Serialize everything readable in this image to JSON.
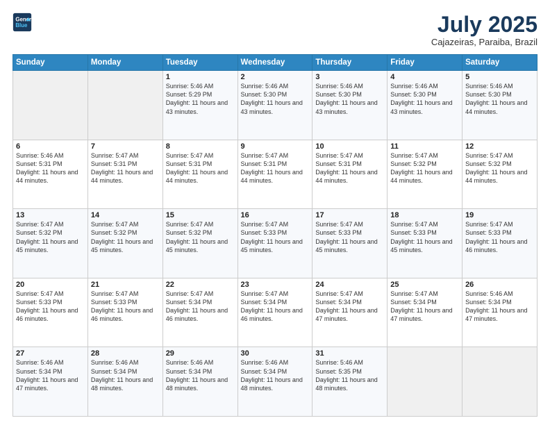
{
  "header": {
    "logo_line1": "General",
    "logo_line2": "Blue",
    "month_title": "July 2025",
    "location": "Cajazeiras, Paraiba, Brazil"
  },
  "weekdays": [
    "Sunday",
    "Monday",
    "Tuesday",
    "Wednesday",
    "Thursday",
    "Friday",
    "Saturday"
  ],
  "weeks": [
    [
      {
        "day": "",
        "sunrise": "",
        "sunset": "",
        "daylight": ""
      },
      {
        "day": "",
        "sunrise": "",
        "sunset": "",
        "daylight": ""
      },
      {
        "day": "1",
        "sunrise": "Sunrise: 5:46 AM",
        "sunset": "Sunset: 5:29 PM",
        "daylight": "Daylight: 11 hours and 43 minutes."
      },
      {
        "day": "2",
        "sunrise": "Sunrise: 5:46 AM",
        "sunset": "Sunset: 5:30 PM",
        "daylight": "Daylight: 11 hours and 43 minutes."
      },
      {
        "day": "3",
        "sunrise": "Sunrise: 5:46 AM",
        "sunset": "Sunset: 5:30 PM",
        "daylight": "Daylight: 11 hours and 43 minutes."
      },
      {
        "day": "4",
        "sunrise": "Sunrise: 5:46 AM",
        "sunset": "Sunset: 5:30 PM",
        "daylight": "Daylight: 11 hours and 43 minutes."
      },
      {
        "day": "5",
        "sunrise": "Sunrise: 5:46 AM",
        "sunset": "Sunset: 5:30 PM",
        "daylight": "Daylight: 11 hours and 44 minutes."
      }
    ],
    [
      {
        "day": "6",
        "sunrise": "Sunrise: 5:46 AM",
        "sunset": "Sunset: 5:31 PM",
        "daylight": "Daylight: 11 hours and 44 minutes."
      },
      {
        "day": "7",
        "sunrise": "Sunrise: 5:47 AM",
        "sunset": "Sunset: 5:31 PM",
        "daylight": "Daylight: 11 hours and 44 minutes."
      },
      {
        "day": "8",
        "sunrise": "Sunrise: 5:47 AM",
        "sunset": "Sunset: 5:31 PM",
        "daylight": "Daylight: 11 hours and 44 minutes."
      },
      {
        "day": "9",
        "sunrise": "Sunrise: 5:47 AM",
        "sunset": "Sunset: 5:31 PM",
        "daylight": "Daylight: 11 hours and 44 minutes."
      },
      {
        "day": "10",
        "sunrise": "Sunrise: 5:47 AM",
        "sunset": "Sunset: 5:31 PM",
        "daylight": "Daylight: 11 hours and 44 minutes."
      },
      {
        "day": "11",
        "sunrise": "Sunrise: 5:47 AM",
        "sunset": "Sunset: 5:32 PM",
        "daylight": "Daylight: 11 hours and 44 minutes."
      },
      {
        "day": "12",
        "sunrise": "Sunrise: 5:47 AM",
        "sunset": "Sunset: 5:32 PM",
        "daylight": "Daylight: 11 hours and 44 minutes."
      }
    ],
    [
      {
        "day": "13",
        "sunrise": "Sunrise: 5:47 AM",
        "sunset": "Sunset: 5:32 PM",
        "daylight": "Daylight: 11 hours and 45 minutes."
      },
      {
        "day": "14",
        "sunrise": "Sunrise: 5:47 AM",
        "sunset": "Sunset: 5:32 PM",
        "daylight": "Daylight: 11 hours and 45 minutes."
      },
      {
        "day": "15",
        "sunrise": "Sunrise: 5:47 AM",
        "sunset": "Sunset: 5:32 PM",
        "daylight": "Daylight: 11 hours and 45 minutes."
      },
      {
        "day": "16",
        "sunrise": "Sunrise: 5:47 AM",
        "sunset": "Sunset: 5:33 PM",
        "daylight": "Daylight: 11 hours and 45 minutes."
      },
      {
        "day": "17",
        "sunrise": "Sunrise: 5:47 AM",
        "sunset": "Sunset: 5:33 PM",
        "daylight": "Daylight: 11 hours and 45 minutes."
      },
      {
        "day": "18",
        "sunrise": "Sunrise: 5:47 AM",
        "sunset": "Sunset: 5:33 PM",
        "daylight": "Daylight: 11 hours and 45 minutes."
      },
      {
        "day": "19",
        "sunrise": "Sunrise: 5:47 AM",
        "sunset": "Sunset: 5:33 PM",
        "daylight": "Daylight: 11 hours and 46 minutes."
      }
    ],
    [
      {
        "day": "20",
        "sunrise": "Sunrise: 5:47 AM",
        "sunset": "Sunset: 5:33 PM",
        "daylight": "Daylight: 11 hours and 46 minutes."
      },
      {
        "day": "21",
        "sunrise": "Sunrise: 5:47 AM",
        "sunset": "Sunset: 5:33 PM",
        "daylight": "Daylight: 11 hours and 46 minutes."
      },
      {
        "day": "22",
        "sunrise": "Sunrise: 5:47 AM",
        "sunset": "Sunset: 5:34 PM",
        "daylight": "Daylight: 11 hours and 46 minutes."
      },
      {
        "day": "23",
        "sunrise": "Sunrise: 5:47 AM",
        "sunset": "Sunset: 5:34 PM",
        "daylight": "Daylight: 11 hours and 46 minutes."
      },
      {
        "day": "24",
        "sunrise": "Sunrise: 5:47 AM",
        "sunset": "Sunset: 5:34 PM",
        "daylight": "Daylight: 11 hours and 47 minutes."
      },
      {
        "day": "25",
        "sunrise": "Sunrise: 5:47 AM",
        "sunset": "Sunset: 5:34 PM",
        "daylight": "Daylight: 11 hours and 47 minutes."
      },
      {
        "day": "26",
        "sunrise": "Sunrise: 5:46 AM",
        "sunset": "Sunset: 5:34 PM",
        "daylight": "Daylight: 11 hours and 47 minutes."
      }
    ],
    [
      {
        "day": "27",
        "sunrise": "Sunrise: 5:46 AM",
        "sunset": "Sunset: 5:34 PM",
        "daylight": "Daylight: 11 hours and 47 minutes."
      },
      {
        "day": "28",
        "sunrise": "Sunrise: 5:46 AM",
        "sunset": "Sunset: 5:34 PM",
        "daylight": "Daylight: 11 hours and 48 minutes."
      },
      {
        "day": "29",
        "sunrise": "Sunrise: 5:46 AM",
        "sunset": "Sunset: 5:34 PM",
        "daylight": "Daylight: 11 hours and 48 minutes."
      },
      {
        "day": "30",
        "sunrise": "Sunrise: 5:46 AM",
        "sunset": "Sunset: 5:34 PM",
        "daylight": "Daylight: 11 hours and 48 minutes."
      },
      {
        "day": "31",
        "sunrise": "Sunrise: 5:46 AM",
        "sunset": "Sunset: 5:35 PM",
        "daylight": "Daylight: 11 hours and 48 minutes."
      },
      {
        "day": "",
        "sunrise": "",
        "sunset": "",
        "daylight": ""
      },
      {
        "day": "",
        "sunrise": "",
        "sunset": "",
        "daylight": ""
      }
    ]
  ]
}
